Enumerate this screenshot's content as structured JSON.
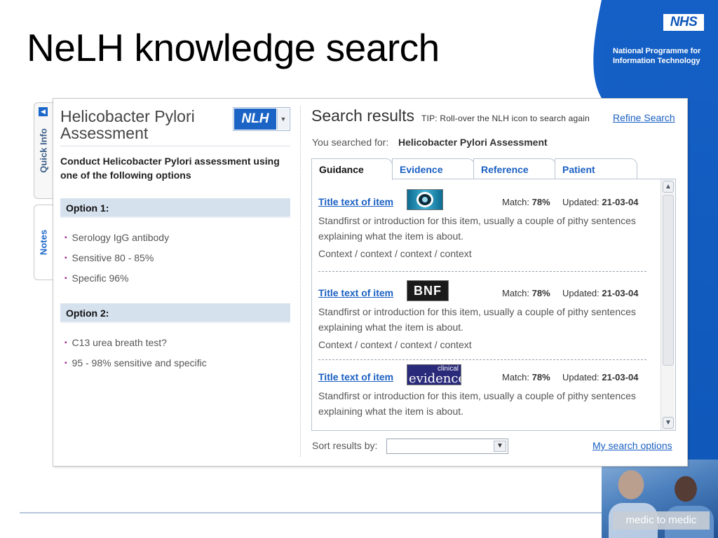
{
  "slide": {
    "title": "NeLH knowledge search",
    "nhs_logo": "NHS",
    "programme": "National Programme for Information Technology",
    "medic_badge": "medic to medic"
  },
  "side_tabs": [
    {
      "label": "Quick Info"
    },
    {
      "label": "Notes"
    }
  ],
  "left_panel": {
    "title": "Helicobacter Pylori Assessment",
    "nlh_button": "NLH",
    "intro": "Conduct Helicobacter Pylori assessment using one of the following options",
    "options": [
      {
        "heading": "Option 1:",
        "items": [
          "Serology IgG antibody",
          "Sensitive 80 - 85%",
          "Specific 96%"
        ]
      },
      {
        "heading": "Option 2:",
        "items": [
          "C13 urea breath test?",
          "95 - 98% sensitive and specific"
        ]
      }
    ]
  },
  "search": {
    "heading": "Search results",
    "tip": "TIP: Roll-over the NLH icon to search again",
    "refine_link": "Refine Search",
    "searched_label": "You searched for:",
    "searched_term": "Helicobacter Pylori Assessment",
    "tabs": [
      {
        "label": "Guidance",
        "active": true
      },
      {
        "label": "Evidence",
        "active": false
      },
      {
        "label": "Reference",
        "active": false
      },
      {
        "label": "Patient",
        "active": false
      }
    ],
    "results": [
      {
        "title": "Title text of item",
        "logo": "guidance-logo",
        "match_label": "Match:",
        "match": "78%",
        "updated_label": "Updated:",
        "updated": "21-03-04",
        "standfirst": "Standfirst or introduction for this item, usually a couple of pithy sentences explaining what the item is about.",
        "context": "Context / context / context / context"
      },
      {
        "title": "Title text of item",
        "logo_text": "BNF",
        "match_label": "Match:",
        "match": "78%",
        "updated_label": "Updated:",
        "updated": "21-03-04",
        "standfirst": "Standfirst or introduction for this item, usually a couple of pithy sentences explaining what the item is about.",
        "context": "Context / context / context / context"
      },
      {
        "title": "Title text of item",
        "logo_small": "clinical",
        "logo_big": "evidence",
        "match_label": "Match:",
        "match": "78%",
        "updated_label": "Updated:",
        "updated": "21-03-04",
        "standfirst": "Standfirst or introduction for this item, usually a couple of pithy sentences explaining what the item is about."
      }
    ],
    "sort_label": "Sort results by:",
    "sort_value": "",
    "my_options_link": "My search options"
  },
  "colors": {
    "nhs_blue": "#0f57b8",
    "link_blue": "#1a5fc2",
    "option_bar": "#d6e1ee",
    "bullet": "#a3268f"
  }
}
